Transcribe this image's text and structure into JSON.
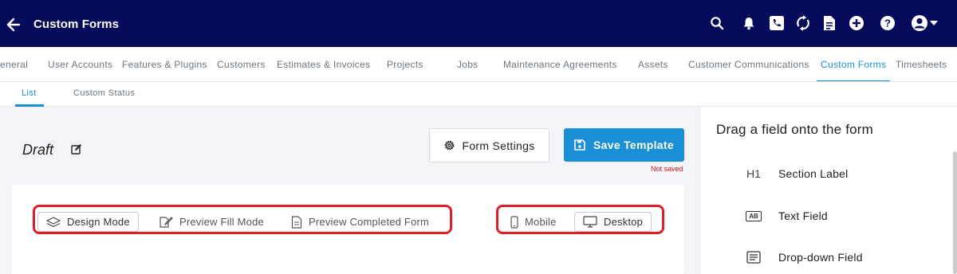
{
  "header": {
    "title": "Custom Forms",
    "icons": [
      "back-arrow-icon",
      "search-icon",
      "bell-icon",
      "phone-icon",
      "sync-icon",
      "document-icon",
      "plus-circle-icon",
      "help-icon",
      "account-icon",
      "caret-down-icon"
    ],
    "background": "#050b5a"
  },
  "tabs": {
    "items": [
      {
        "label": "eneral"
      },
      {
        "label": "User Accounts"
      },
      {
        "label": "Features & Plugins"
      },
      {
        "label": "Customers"
      },
      {
        "label": "Estimates & Invoices"
      },
      {
        "label": "Projects"
      },
      {
        "label": "Jobs"
      },
      {
        "label": "Maintenance Agreements"
      },
      {
        "label": "Assets"
      },
      {
        "label": "Customer Communications"
      },
      {
        "label": "Custom Forms",
        "active": true
      },
      {
        "label": "Timesheets"
      }
    ],
    "accent": "#1a8fd6"
  },
  "subtabs": {
    "items": [
      {
        "label": "List",
        "active": true
      },
      {
        "label": "Custom Status"
      }
    ]
  },
  "main": {
    "form_name": "Draft",
    "settings_label": "Form Settings",
    "save_label": "Save Template",
    "status": "Not saved",
    "modes": {
      "design": "Design Mode",
      "preview_fill": "Preview Fill Mode",
      "preview_completed": "Preview Completed Form",
      "selected": "Design Mode"
    },
    "devices": {
      "mobile": "Mobile",
      "desktop": "Desktop",
      "selected": "Desktop"
    },
    "highlight_color": "#dd1f26"
  },
  "panel": {
    "title": "Drag a field onto the form",
    "fields": [
      {
        "icon": "heading-icon",
        "icon_text": "H1",
        "label": "Section Label"
      },
      {
        "icon": "text-field-icon",
        "icon_text": "AB",
        "label": "Text Field"
      },
      {
        "icon": "dropdown-field-icon",
        "icon_text": "",
        "label": "Drop-down Field"
      }
    ]
  }
}
